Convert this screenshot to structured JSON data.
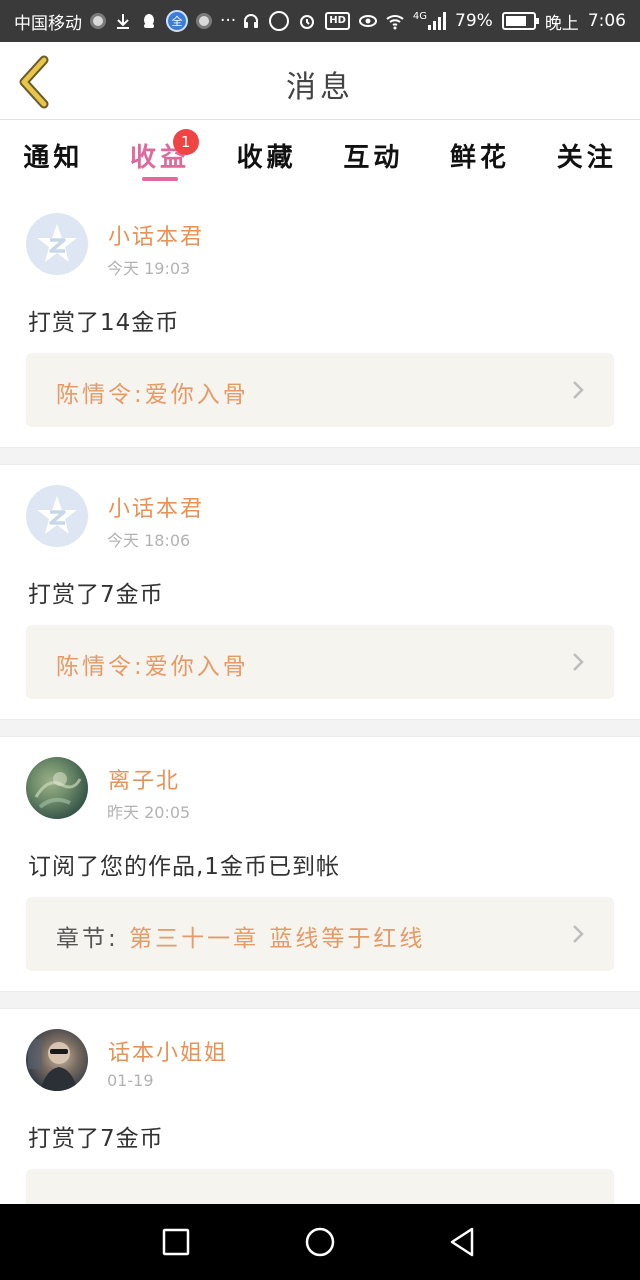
{
  "status_bar": {
    "carrier": "中国移动",
    "network": "4G",
    "battery_percent_text": "79%",
    "battery_level": 0.79,
    "time_prefix": "晚上",
    "time": "7:06",
    "icons": [
      "browser-icon",
      "download-icon",
      "qq-icon",
      "quanmin-icon",
      "browser-icon",
      "more-icon",
      "headset-icon",
      "data-saver-icon",
      "alarm-icon",
      "hd-icon",
      "eye-icon",
      "wifi-icon",
      "signal-icon",
      "battery-icon"
    ]
  },
  "header": {
    "title": "消息"
  },
  "tabs": [
    {
      "label": "通知",
      "active": false,
      "badge": ""
    },
    {
      "label": "收益",
      "active": true,
      "badge": "1"
    },
    {
      "label": "收藏",
      "active": false,
      "badge": ""
    },
    {
      "label": "互动",
      "active": false,
      "badge": ""
    },
    {
      "label": "鲜花",
      "active": false,
      "badge": ""
    },
    {
      "label": "关注",
      "active": false,
      "badge": ""
    }
  ],
  "feed": [
    {
      "user": "小话本君",
      "time": "今天 19:03",
      "message": "打赏了14金币",
      "link_prefix": "",
      "link_title": "陈情令:爱你入骨",
      "avatar": "default-avatar"
    },
    {
      "user": "小话本君",
      "time": "今天 18:06",
      "message": "打赏了7金币",
      "link_prefix": "",
      "link_title": "陈情令:爱你入骨",
      "avatar": "default-avatar"
    },
    {
      "user": "离子北",
      "time": "昨天 20:05",
      "message": "订阅了您的作品,1金币已到帐",
      "link_prefix": "章节: ",
      "link_title": "第三十一章 蓝线等于红线",
      "avatar": "photo-avatar"
    },
    {
      "user": "话本小姐姐",
      "time": "01-19",
      "message": "打赏了7金币",
      "link_prefix": "",
      "link_title": "",
      "avatar": "photo-avatar"
    }
  ],
  "colors": {
    "accent_pink": "#e0689a",
    "username_orange": "#e6935a",
    "link_orange": "#e79966",
    "badge_red": "#f04343",
    "back_arrow": "#c9a23a"
  }
}
